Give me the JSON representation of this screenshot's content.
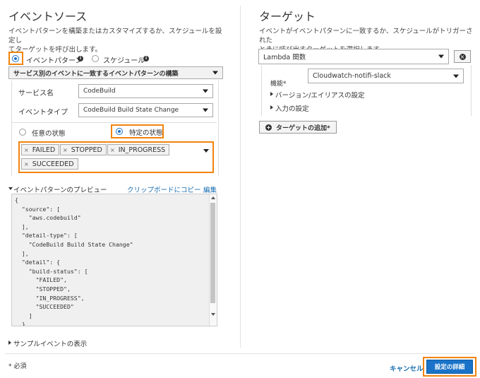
{
  "left": {
    "title": "イベントソース",
    "description_line1": "イベントパターンを構築またはカスタマイズするか、スケジュールを設定し",
    "description_line2": "てターゲットを呼び出します。",
    "radio_event_pattern": "イベントパターン",
    "radio_schedule": "スケジュール",
    "pattern_mode_select": "サービス別のイベントに一致するイベントパターンの構築",
    "service_name_label": "サービス名",
    "service_name_value": "CodeBuild",
    "event_type_label": "イベントタイプ",
    "event_type_value": "CodeBuild Build State Change",
    "radio_any_state": "任意の状態",
    "radio_specific_state": "特定の状態",
    "states": [
      "FAILED",
      "STOPPED",
      "IN_PROGRESS",
      "SUCCEEDED"
    ],
    "preview_title": "イベントパターンのプレビュー",
    "copy_link": "クリップボードにコピー",
    "edit_link": "編集",
    "code_lines": [
      "{",
      "  \"source\": [",
      "    \"aws.codebuild\"",
      "  ],",
      "  \"detail-type\": [",
      "    \"CodeBuild Build State Change\"",
      "  ],",
      "  \"detail\": {",
      "    \"build-status\": [",
      "      \"FAILED\",",
      "      \"STOPPED\",",
      "      \"IN_PROGRESS\",",
      "      \"SUCCEEDED\"",
      "    ]",
      "  }"
    ],
    "sample_events": "サンプルイベントの表示"
  },
  "right": {
    "title": "ターゲット",
    "description_line1": "イベントがイベントパターンに一致するか、スケジュールがトリガーされた",
    "description_line2": "ときに呼び出すターゲットを選択します。",
    "target_type": "Lambda 関数",
    "function_label": "機能*",
    "function_value": "Cloudwatch-notifi-slack",
    "version_alias": "バージョン/エイリアスの設定",
    "input_config": "入力の設定",
    "add_target": "ターゲットの追加*"
  },
  "footer": {
    "required_note": "* 必須",
    "cancel": "キャンセル",
    "configure_details": "設定の詳細"
  },
  "colors": {
    "highlight": "#f0840e",
    "link": "#1a6fb0",
    "primary": "#1a73c9"
  }
}
